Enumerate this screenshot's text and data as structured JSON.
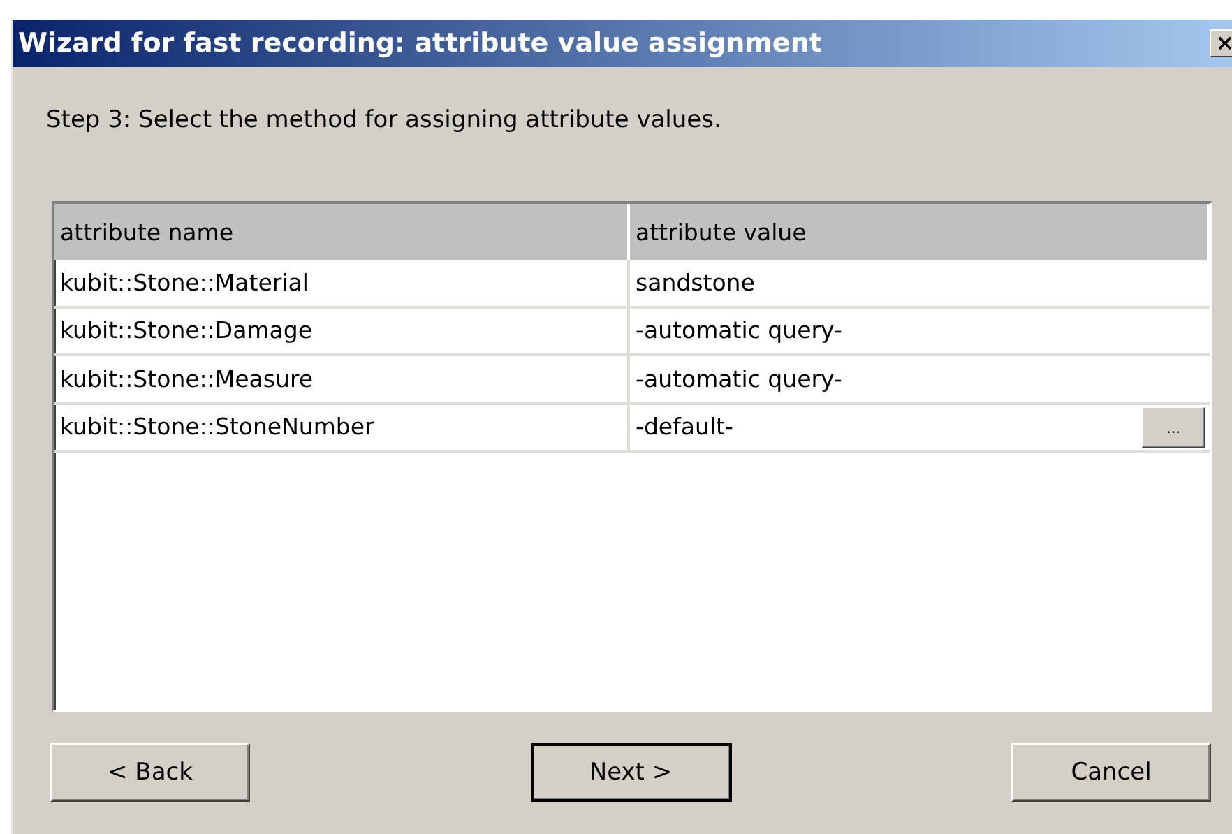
{
  "window": {
    "title": "Wizard for fast recording: attribute value assignment",
    "close": "×"
  },
  "instruction": "Step 3: Select the method for assigning attribute values.",
  "table": {
    "columns": [
      "attribute name",
      "attribute value"
    ],
    "rows": [
      {
        "name": "kubit::Stone::Material",
        "value": "sandstone"
      },
      {
        "name": "kubit::Stone::Damage",
        "value": "-automatic query-"
      },
      {
        "name": "kubit::Stone::Measure",
        "value": "-automatic query-"
      },
      {
        "name": "kubit::Stone::StoneNumber",
        "value": "-default-",
        "browse_label": "..."
      }
    ]
  },
  "buttons": [
    {
      "label": "< Back",
      "is_default": false
    },
    {
      "label": "Next >",
      "is_default": true
    },
    {
      "label": "Cancel",
      "is_default": false
    }
  ]
}
